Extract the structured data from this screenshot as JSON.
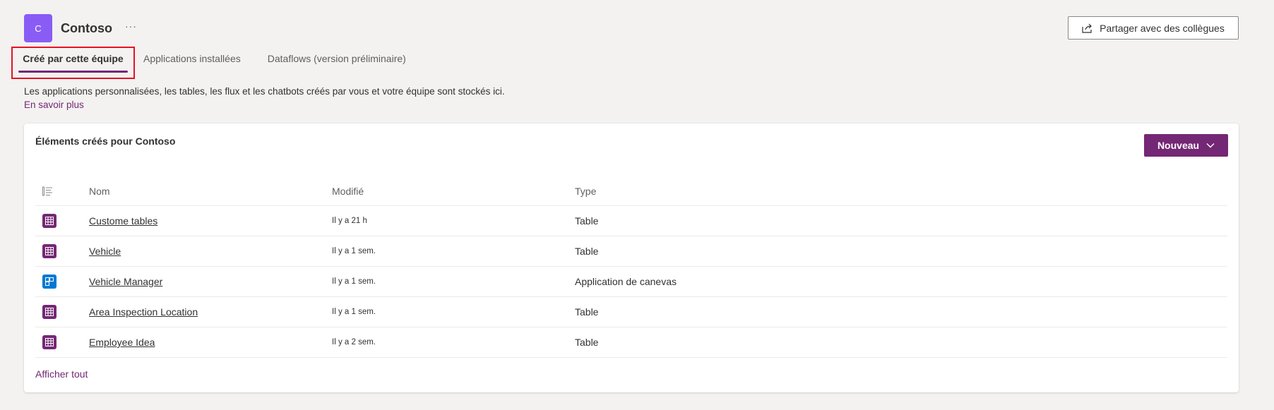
{
  "header": {
    "avatar_letter": "C",
    "team_name": "Contoso",
    "more": "···",
    "share_label": "Partager avec des collègues"
  },
  "tabs": [
    {
      "label": "Créé par cette équipe",
      "active": true
    },
    {
      "label": "Applications installées",
      "active": false
    },
    {
      "label": "Dataflows (version préliminaire)",
      "active": false
    }
  ],
  "description": "Les applications personnalisées, les tables, les flux et les chatbots créés par vous et votre équipe sont stockés ici.",
  "learn_more": "En savoir plus",
  "card": {
    "title": "Éléments créés pour Contoso",
    "new_label": "Nouveau",
    "columns": {
      "name": "Nom",
      "modified": "Modifié",
      "type": "Type"
    },
    "rows": [
      {
        "icon": "table-icon",
        "name": "Custome tables",
        "modified": "Il y a 21  h",
        "type": "Table"
      },
      {
        "icon": "table-icon",
        "name": "Vehicle",
        "modified": "Il y a 1 sem.",
        "type": "Table"
      },
      {
        "icon": "canvas-app-icon",
        "name": "Vehicle Manager",
        "modified": "Il y a 1 sem.",
        "type": "Application de canevas"
      },
      {
        "icon": "table-icon",
        "name": "Area Inspection Location",
        "modified": "Il y a 1 sem.",
        "type": "Table"
      },
      {
        "icon": "table-icon",
        "name": "Employee Idea",
        "modified": "Il y a 2 sem.",
        "type": "Table"
      }
    ],
    "show_all": "Afficher tout"
  },
  "colors": {
    "accent": "#742774",
    "avatar": "#8a5cf6",
    "canvas_icon": "#0078d4",
    "highlight_border": "#e81123"
  }
}
